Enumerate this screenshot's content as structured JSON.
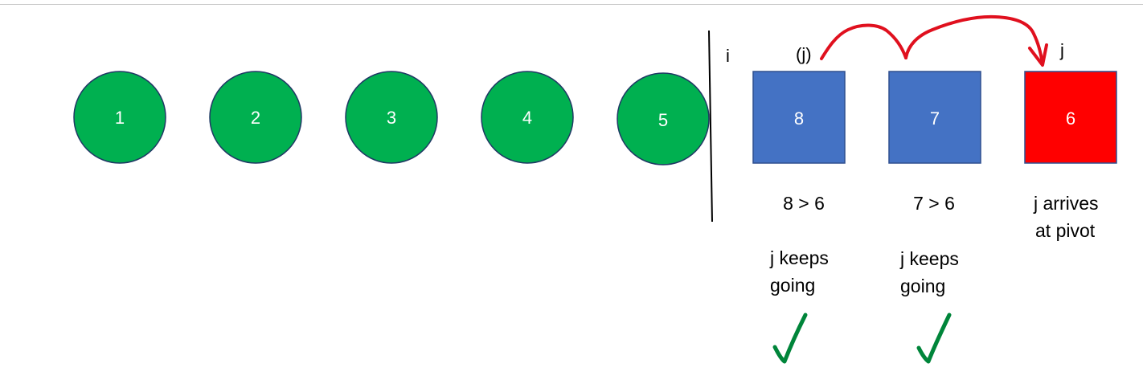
{
  "colors": {
    "sorted_circle_fill": "#00b050",
    "sorted_circle_stroke": "#1f3864",
    "unsorted_box_fill": "#4472c4",
    "pivot_box_fill": "#ff0000",
    "box_stroke": "#2f4f8f",
    "arrow_color": "#e0101e",
    "check_color": "#00853a",
    "divider_color": "#000000"
  },
  "sorted_elements": [
    "1",
    "2",
    "3",
    "4",
    "5"
  ],
  "pointers": {
    "i_label": "i",
    "j_prev_label": "(j)",
    "j_label": "j"
  },
  "boxes": [
    {
      "value": "8",
      "role": "unsorted"
    },
    {
      "value": "7",
      "role": "unsorted"
    },
    {
      "value": "6",
      "role": "pivot"
    }
  ],
  "comparisons": [
    {
      "line1": "8 > 6"
    },
    {
      "line1": "7 > 6"
    },
    {
      "line1": "j arrives",
      "line2": "at pivot"
    }
  ],
  "notes": [
    {
      "line1": "j keeps",
      "line2": "going"
    },
    {
      "line1": "j keeps",
      "line2": "going"
    }
  ],
  "icons": {
    "arrow": "curved-hop-arrow-icon",
    "check": "checkmark-icon"
  }
}
